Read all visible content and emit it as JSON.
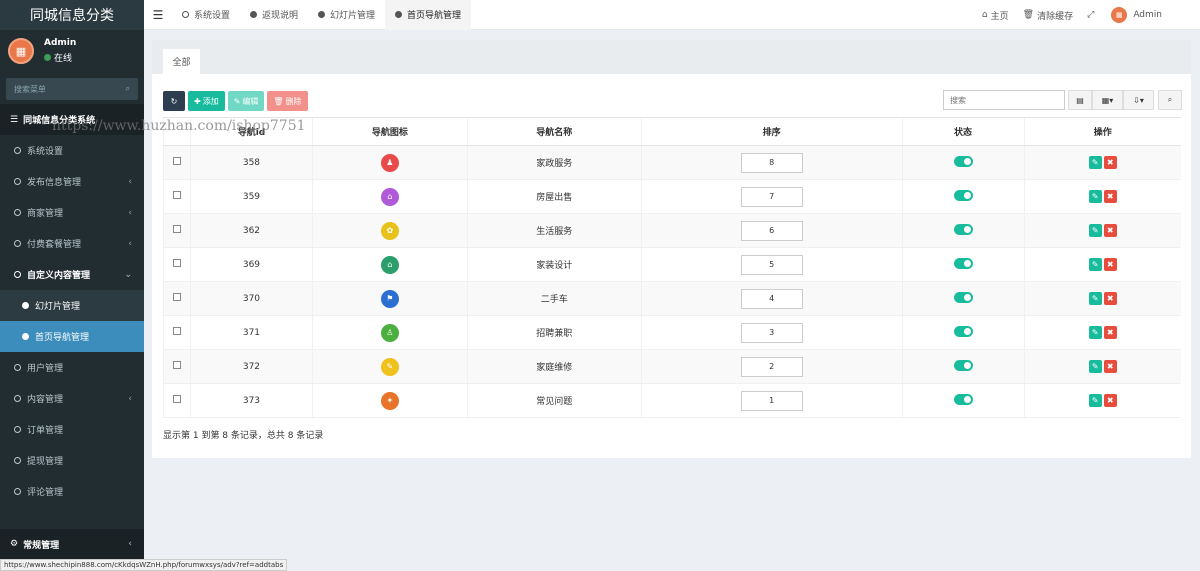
{
  "app": {
    "brand": "同城信息分类"
  },
  "user": {
    "name": "Admin",
    "status": "在线"
  },
  "sidebar": {
    "search_placeholder": "搜索菜单",
    "header": "同城信息分类系统",
    "items": [
      {
        "label": "系统设置",
        "caret": false
      },
      {
        "label": "发布信息管理",
        "caret": true
      },
      {
        "label": "商家管理",
        "caret": true
      },
      {
        "label": "付费套餐管理",
        "caret": true
      },
      {
        "label": "自定义内容管理",
        "caret": true,
        "open": true
      }
    ],
    "subitems": [
      {
        "label": "幻灯片管理",
        "active": false
      },
      {
        "label": "首页导航管理",
        "active": true
      }
    ],
    "items_after": [
      {
        "label": "用户管理",
        "caret": false
      },
      {
        "label": "内容管理",
        "caret": true
      },
      {
        "label": "订单管理",
        "caret": false
      },
      {
        "label": "提现管理",
        "caret": false
      },
      {
        "label": "评论管理",
        "caret": false
      }
    ],
    "footer": "常规管理"
  },
  "topbar": {
    "tabs": [
      {
        "label": "系统设置",
        "active": false,
        "filled": false
      },
      {
        "label": "返现说明",
        "active": false,
        "filled": true
      },
      {
        "label": "幻灯片管理",
        "active": false,
        "filled": true
      },
      {
        "label": "首页导航管理",
        "active": true,
        "filled": true
      }
    ],
    "home": "主页",
    "clear_cache": "清除缓存",
    "admin": "Admin"
  },
  "content": {
    "tab_all": "全部",
    "toolbar": {
      "add": "添加",
      "edit": "编辑",
      "delete": "删除"
    },
    "search_placeholder": "搜索",
    "table": {
      "headers": [
        "导航id",
        "导航图标",
        "导航名称",
        "排序",
        "状态",
        "操作"
      ],
      "rows": [
        {
          "id": "358",
          "name": "家政服务",
          "weigh": "8",
          "icon_color": "#e84a4a",
          "icon": "♟"
        },
        {
          "id": "359",
          "name": "房屋出售",
          "weigh": "7",
          "icon_color": "#b05ad8",
          "icon": "⌂"
        },
        {
          "id": "362",
          "name": "生活服务",
          "weigh": "6",
          "icon_color": "#e8c21a",
          "icon": "✿"
        },
        {
          "id": "369",
          "name": "家装设计",
          "weigh": "5",
          "icon_color": "#2b9e6b",
          "icon": "⌂"
        },
        {
          "id": "370",
          "name": "二手车",
          "weigh": "4",
          "icon_color": "#2c6fd1",
          "icon": "⚑"
        },
        {
          "id": "371",
          "name": "招聘兼职",
          "weigh": "3",
          "icon_color": "#4cae3f",
          "icon": "♙"
        },
        {
          "id": "372",
          "name": "家庭维修",
          "weigh": "2",
          "icon_color": "#f0c01c",
          "icon": "✎"
        },
        {
          "id": "373",
          "name": "常见问题",
          "weigh": "1",
          "icon_color": "#e8742a",
          "icon": "✦"
        }
      ]
    },
    "pager_info": "显示第 1 到第 8 条记录，总共 8 条记录"
  },
  "watermark": "https://www.huzhan.com/ishop7751",
  "statusbar": "https://www.shechipin888.com/cKkdqsWZnH.php/forumwxsys/adv?ref=addtabs"
}
